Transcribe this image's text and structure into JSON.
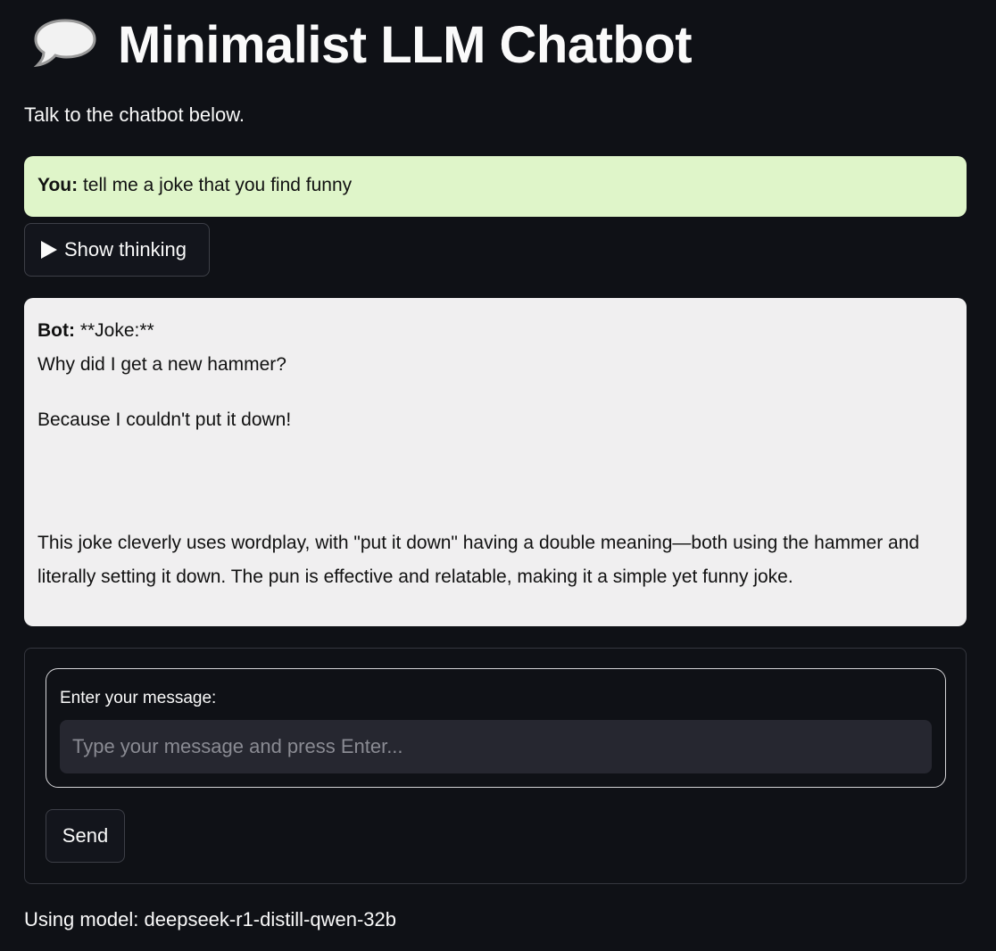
{
  "header": {
    "icon": "speech-bubble-icon",
    "title": "Minimalist LLM Chatbot",
    "subtitle": "Talk to the chatbot below."
  },
  "messages": {
    "user": {
      "speaker": "You:",
      "text": "tell me a joke that you find funny"
    },
    "thinking_toggle_label": "Show thinking",
    "bot": {
      "speaker": "Bot:",
      "first_line": "**Joke:**",
      "line2": "Why did I get a new hammer?",
      "line3": "Because I couldn't put it down!",
      "explanation": "This joke cleverly uses wordplay, with \"put it down\" having a double meaning—both using the hammer and literally setting it down. The pun is effective and relatable, making it a simple yet funny joke."
    }
  },
  "form": {
    "input_label": "Enter your message:",
    "input_value": "",
    "input_placeholder": "Type your message and press Enter...",
    "send_label": "Send"
  },
  "footer": {
    "model_text": "Using model: deepseek-r1-distill-qwen-32b"
  },
  "colors": {
    "background": "#0f1116",
    "user_bubble": "#dff5c9",
    "bot_bubble": "#f0eff0",
    "input_background": "#262730"
  }
}
